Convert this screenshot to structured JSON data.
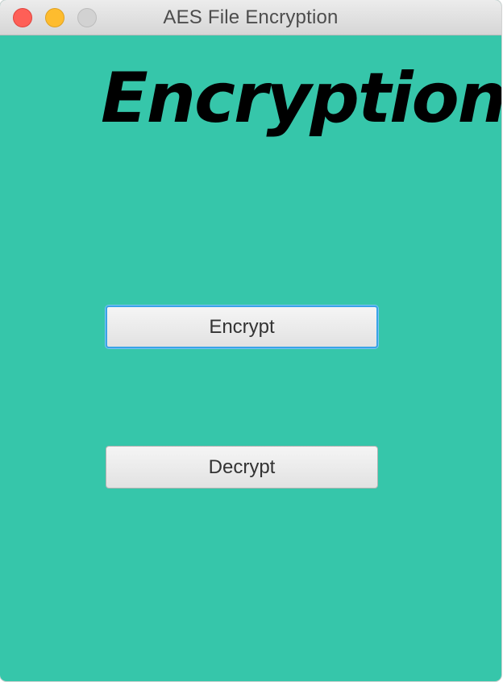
{
  "window": {
    "title": "AES File Encryption",
    "background_color": "#36c6aa"
  },
  "titlebar": {
    "close_icon": "close-dot-icon",
    "minimize_icon": "minimize-dot-icon",
    "zoom_icon": "zoom-dot-icon"
  },
  "main": {
    "heading": "Encryption",
    "encrypt_label": "Encrypt",
    "decrypt_label": "Decrypt"
  }
}
